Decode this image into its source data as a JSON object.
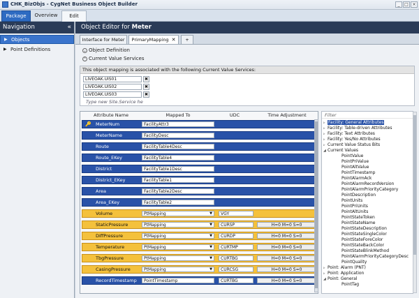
{
  "window": {
    "title": "CHK_BizObjs - CygNet Business Object Builder",
    "minimize": "_",
    "maximize": "□",
    "close": "×"
  },
  "ribbon": {
    "tabs": [
      {
        "label": "Package"
      },
      {
        "label": "Overview"
      },
      {
        "label": "Edit"
      }
    ]
  },
  "nav": {
    "title": "Navigation",
    "collapse": "«",
    "items": [
      {
        "label": "Objects"
      },
      {
        "label": "Point Definitions"
      }
    ]
  },
  "editor": {
    "title_prefix": "Object Editor for ",
    "title_obj": "Meter",
    "tabs": [
      {
        "label": "Interface for Meter"
      },
      {
        "label": "PrimaryMapping"
      },
      {
        "label": "+"
      }
    ],
    "tab_close": "✕",
    "sections": {
      "object_definition": "Object Definition",
      "current_value_services": "Current Value Services"
    }
  },
  "cvs": {
    "banner": "This object mapping is associated with the following Current Value Services:",
    "services": [
      "LIVEOAK.UIS01",
      "LIVEOAK.UIS02",
      "LIVEOAK.UIS03"
    ],
    "new_placeholder": "Type new Site.Service he"
  },
  "grid": {
    "columns": [
      "Attribute Name",
      "Mapped To",
      "UDC",
      "Time Adjustment"
    ],
    "rows": [
      {
        "name": "MeterNum",
        "mapped": "FacilityAttr3",
        "udc": "",
        "tadj": "",
        "key": true,
        "color": "blue"
      },
      {
        "name": "MeterName",
        "mapped": "FacilityDesc",
        "udc": "",
        "tadj": "",
        "key": false,
        "color": "blue"
      },
      {
        "name": "Route",
        "mapped": "FacilityTable4Desc",
        "udc": "",
        "tadj": "",
        "key": false,
        "color": "blue"
      },
      {
        "name": "Route_EKey",
        "mapped": "FacilityTable4",
        "udc": "",
        "tadj": "",
        "key": false,
        "color": "blue"
      },
      {
        "name": "District",
        "mapped": "FacilityTable1Desc",
        "udc": "",
        "tadj": "",
        "key": false,
        "color": "blue"
      },
      {
        "name": "District_EKey",
        "mapped": "FacilityTable1",
        "udc": "",
        "tadj": "",
        "key": false,
        "color": "blue"
      },
      {
        "name": "Area",
        "mapped": "FacilityTable2Desc",
        "udc": "",
        "tadj": "",
        "key": false,
        "color": "blue"
      },
      {
        "name": "Area_EKey",
        "mapped": "FacilityTable2",
        "udc": "",
        "tadj": "",
        "key": false,
        "color": "blue"
      },
      {
        "name": "Volume",
        "mapped": "PtMapping",
        "udc": "VGY",
        "tadj": "",
        "key": false,
        "color": "orange"
      },
      {
        "name": "StaticPressure",
        "mapped": "PtMapping",
        "udc": "CURSP",
        "tadj": "H=0 M=0 S=0",
        "key": false,
        "color": "orange"
      },
      {
        "name": "DiffPressure",
        "mapped": "PtMapping",
        "udc": "CURDP",
        "tadj": "H=0 M=0 S=0",
        "key": false,
        "color": "orange"
      },
      {
        "name": "Temperature",
        "mapped": "PtMapping",
        "udc": "CURTMP",
        "tadj": "H=0 M=0 S=0",
        "key": false,
        "color": "orange"
      },
      {
        "name": "TbgPressure",
        "mapped": "PtMapping",
        "udc": "CURTBG",
        "tadj": "H=0 M=0 S=0",
        "key": false,
        "color": "orange"
      },
      {
        "name": "CasingPressure",
        "mapped": "PtMapping",
        "udc": "CURCSG",
        "tadj": "H=0 M=0 S=0",
        "key": false,
        "color": "orange"
      },
      {
        "name": "RecordTimestamp",
        "mapped": "PointTimestamp",
        "udc": "CURTBG",
        "tadj": "H=0 M=0 S=0",
        "key": false,
        "color": "blue"
      }
    ]
  },
  "tree": {
    "filter_placeholder": "Filter",
    "nodes": [
      {
        "label": "Facility: General Attributes",
        "level": 0,
        "exp": "▹",
        "sel": true
      },
      {
        "label": "Facility: Table-driven Attributes",
        "level": 0,
        "exp": "▹"
      },
      {
        "label": "Facility: Text Attributes",
        "level": 0,
        "exp": "▹"
      },
      {
        "label": "Facility: Yes/No Attributes",
        "level": 0,
        "exp": "▹"
      },
      {
        "label": "Current Value Status Bits",
        "level": 0,
        "exp": "▹"
      },
      {
        "label": "Current Values",
        "level": 0,
        "exp": "◢"
      },
      {
        "label": "PointValue",
        "level": 1
      },
      {
        "label": "PointPriValue",
        "level": 1
      },
      {
        "label": "PointAltValue",
        "level": 1
      },
      {
        "label": "PointTimestamp",
        "level": 1
      },
      {
        "label": "PointAlarmAck",
        "level": 1
      },
      {
        "label": "PointAlarmRecordVersion",
        "level": 1
      },
      {
        "label": "PointAlarmPriorityCategory",
        "level": 1
      },
      {
        "label": "PointDescription",
        "level": 1
      },
      {
        "label": "PointUnits",
        "level": 1
      },
      {
        "label": "PointPriUnits",
        "level": 1
      },
      {
        "label": "PointAltUnits",
        "level": 1
      },
      {
        "label": "PointStateToken",
        "level": 1
      },
      {
        "label": "PointStateName",
        "level": 1
      },
      {
        "label": "PointStateDescription",
        "level": 1
      },
      {
        "label": "PointStateSingleColor",
        "level": 1
      },
      {
        "label": "PointStateForeColor",
        "level": 1
      },
      {
        "label": "PointStateBackColor",
        "level": 1
      },
      {
        "label": "PointStateBlinkMethod",
        "level": 1
      },
      {
        "label": "PointAlarmPriorityCategoryDesc",
        "level": 1
      },
      {
        "label": "PointQuality",
        "level": 1
      },
      {
        "label": "Point: Alarm (PNT)",
        "level": 0,
        "exp": "▹"
      },
      {
        "label": "Point: Application",
        "level": 0,
        "exp": "▹"
      },
      {
        "label": "Point: General",
        "level": 0,
        "exp": "◢"
      },
      {
        "label": "PointTag",
        "level": 1
      }
    ]
  },
  "colors": {
    "blue_row": "#2952a8",
    "orange_row": "#f4c13c",
    "header_dark": "#2a3b57",
    "selected": "#3a74cc"
  }
}
